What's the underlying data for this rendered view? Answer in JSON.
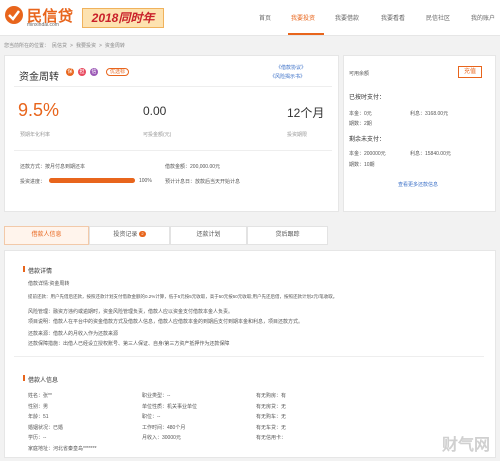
{
  "brand": {
    "name": "民信贷",
    "domain": "minxindai.com",
    "banner": "2018同时年"
  },
  "nav": [
    "首页",
    "我要投资",
    "我要借款",
    "我要看看",
    "民信社区",
    "我的账户"
  ],
  "breadcrumb": [
    "您当前所在的位置：",
    "民信贷",
    ">",
    "我要投资",
    ">",
    "资金周转"
  ],
  "loan": {
    "title": "资金周转",
    "tags": [
      "保",
      "担",
      "信"
    ],
    "pill": "优选标",
    "link1": "《借款协议》",
    "link2": "《风险揭示书》",
    "rate": "9.5%",
    "rate_label": "预期年化利率",
    "available": "0.00",
    "available_label": "可投金额(元)",
    "term": "12个月",
    "term_label": "投资期限",
    "repay_label": "还款方式：",
    "repay_value": "按月付息到期还本",
    "total_label": "借款金额：",
    "total_value": "200,000.00元",
    "progress_label": "投资进度：",
    "progress_value": "100%",
    "progress": 1.0,
    "expected_label": "预计计息日：",
    "expected_value": "放款后当天开始计息"
  },
  "side": {
    "status": "可用余额",
    "button": "充值",
    "paid_title": "已按时支付：",
    "paid_principal": "本金：0元",
    "paid_interest": "利息：3168.00元",
    "paid_periods": "期数：2期",
    "unpaid_title": "剩余未支付：",
    "unpaid_principal": "本金：200000元",
    "unpaid_interest": "利息：15840.00元",
    "unpaid_periods": "期数：10期",
    "more": "查看更多还款信息"
  },
  "tabs": [
    {
      "label": "借款人信息"
    },
    {
      "label": "投资记录",
      "badge": "2"
    },
    {
      "label": "还款计划"
    },
    {
      "label": "贷后跟踪"
    }
  ],
  "details": {
    "title": "借款详情",
    "lines": [
      "借款详情:资金周转",
      "提前还款：用户先借后还款，按照还款计划支付借款金额的0.2%计算，低于5元按5元收取，高于50元按50元收取;用户先还后借，按照还款计划2元/笔收取。",
      "风险管理：融资方违约或逾期时，资金风险管理负责，借款人应以资金支付借款本金人负责。",
      "项目说明：借款人在平台中的资金借款方式及借款人信息，借款人应借款本金的到期后支付到期本金和利息，项目还款方式。",
      "还款来源：借款人的月收入作为还款来源",
      "还款保障措施：出借人已经设立授权账号、第三人保证、自身/第三方资产抵押作为还款保障"
    ]
  },
  "borrower": {
    "title": "借款人信息",
    "rows": [
      [
        "姓名：张**",
        "职业类型：--",
        "有无购房：有"
      ],
      [
        "性别：男",
        "单位性质：机关事业单位",
        "有无房贷：无"
      ],
      [
        "年龄：51",
        "职位：--",
        "有无购车：无"
      ],
      [
        "婚姻状况：已婚",
        "工作时间：480个月",
        "有无车贷：无"
      ],
      [
        "学历：--",
        "月收入：30000元",
        "有无信用卡："
      ],
      [
        "家庭地址：河北省秦皇岛*******",
        "",
        ""
      ]
    ]
  },
  "watermark": "财气网"
}
